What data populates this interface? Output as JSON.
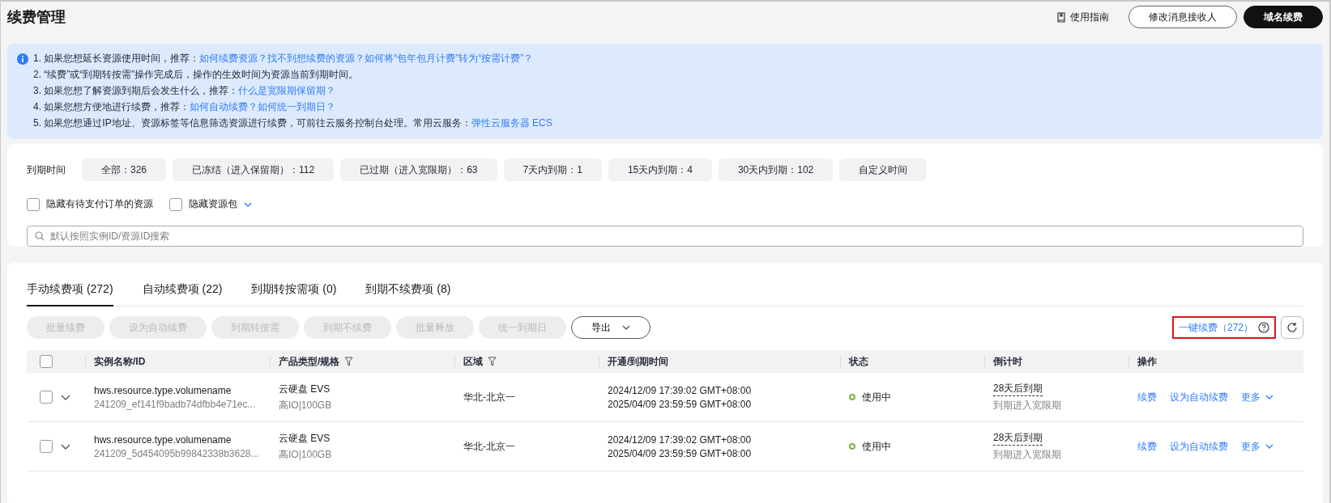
{
  "header": {
    "title": "续费管理",
    "guide_link": "使用指南",
    "buttons": [
      {
        "label": "修改消息接收人",
        "kind": "outline"
      },
      {
        "label": "域名续费",
        "kind": "primary"
      }
    ]
  },
  "notice": {
    "lines": [
      {
        "text": "1. 如果您想延长资源使用时间，推荐：",
        "links": [
          "如何续费资源？",
          "找不到想续费的资源？",
          "如何将“包年包月计费”转为“按需计费”？"
        ]
      },
      {
        "text": "2. “续费”或“到期转按需”操作完成后，操作的生效时间为资源当前到期时间。"
      },
      {
        "text": "3. 如果您想了解资源到期后会发生什么，推荐：",
        "links": [
          "什么是宽限期保留期？"
        ]
      },
      {
        "text": "4. 如果您想方便地进行续费，推荐：",
        "links": [
          "如何自动续费？",
          "如何统一到期日？"
        ]
      },
      {
        "text": "5. 如果您想通过IP地址、资源标签等信息筛选资源进行续费，可前往云服务控制台处理。常用云服务：",
        "links": [
          "弹性云服务器 ECS"
        ]
      }
    ]
  },
  "filters": {
    "label": "到期时间",
    "options": [
      {
        "label": "全部：326",
        "selected": false
      },
      {
        "label": "已冻结（进入保留期）：112",
        "selected": false
      },
      {
        "label": "已过期（进入宽限期）：63",
        "selected": false
      },
      {
        "label": "7天内到期：1",
        "selected": false
      },
      {
        "label": "15天内到期：4",
        "selected": false
      },
      {
        "label": "30天内到期：102",
        "selected": false
      },
      {
        "label": "自定义时间",
        "selected": false
      }
    ],
    "checkboxes": [
      {
        "label": "隐藏有待支付订单的资源",
        "checked": false,
        "dropdown": false
      },
      {
        "label": "隐藏资源包",
        "checked": false,
        "dropdown": true
      }
    ],
    "search": {
      "placeholder": "默认按照实例ID/资源ID搜索"
    }
  },
  "tabs": [
    {
      "label": "手动续费项 (272)",
      "selected": true
    },
    {
      "label": "自动续费项 (22)",
      "selected": false
    },
    {
      "label": "到期转按需项 (0)",
      "selected": false
    },
    {
      "label": "到期不续费项 (8)",
      "selected": false
    }
  ],
  "toolbar": {
    "buttons": [
      {
        "label": "批量续费",
        "disabled": true
      },
      {
        "label": "设为自动续费",
        "disabled": true
      },
      {
        "label": "到期转按需",
        "disabled": true
      },
      {
        "label": "到期不续费",
        "disabled": true
      },
      {
        "label": "批量释放",
        "disabled": true
      },
      {
        "label": "统一到期日",
        "disabled": true
      }
    ],
    "export": "导出",
    "one_click": "一键续费（272）"
  },
  "table": {
    "columns": [
      {
        "label": "实例名称/ID",
        "filter": false
      },
      {
        "label": "产品类型/规格",
        "filter": true
      },
      {
        "label": "区域",
        "filter": true
      },
      {
        "label": "开通/到期时间",
        "filter": false
      },
      {
        "label": "状态",
        "filter": false
      },
      {
        "label": "倒计时",
        "filter": false
      },
      {
        "label": "操作",
        "filter": false
      }
    ],
    "select_all": {
      "checked": false
    },
    "rows": [
      {
        "checked": false,
        "name": "hws.resource.type.volumename",
        "id": "241209_ef141f9badb74dfbb4e71ec...",
        "product": "云硬盘 EVS",
        "spec": "高IO|100GB",
        "region": "华北-北京一",
        "opened": "2024/12/09 17:39:02 GMT+08:00",
        "expires": "2025/04/09 23:59:59 GMT+08:00",
        "status": "使用中",
        "color": "#7cb342",
        "countdown": "28天后到期",
        "countdown_note": "到期进入宽限期",
        "actions": [
          "续费",
          "设为自动续费"
        ],
        "more": "更多"
      },
      {
        "checked": false,
        "name": "hws.resource.type.volumename",
        "id": "241209_5d454095b99842338b3628...",
        "product": "云硬盘 EVS",
        "spec": "高IO|100GB",
        "region": "华北-北京一",
        "opened": "2024/12/09 17:39:02 GMT+08:00",
        "expires": "2025/04/09 23:59:59 GMT+08:00",
        "status": "使用中",
        "color": "#7cb342",
        "countdown": "28天后到期",
        "countdown_note": "到期进入宽限期",
        "actions": [
          "续费",
          "设为自动续费"
        ],
        "more": "更多"
      }
    ]
  }
}
